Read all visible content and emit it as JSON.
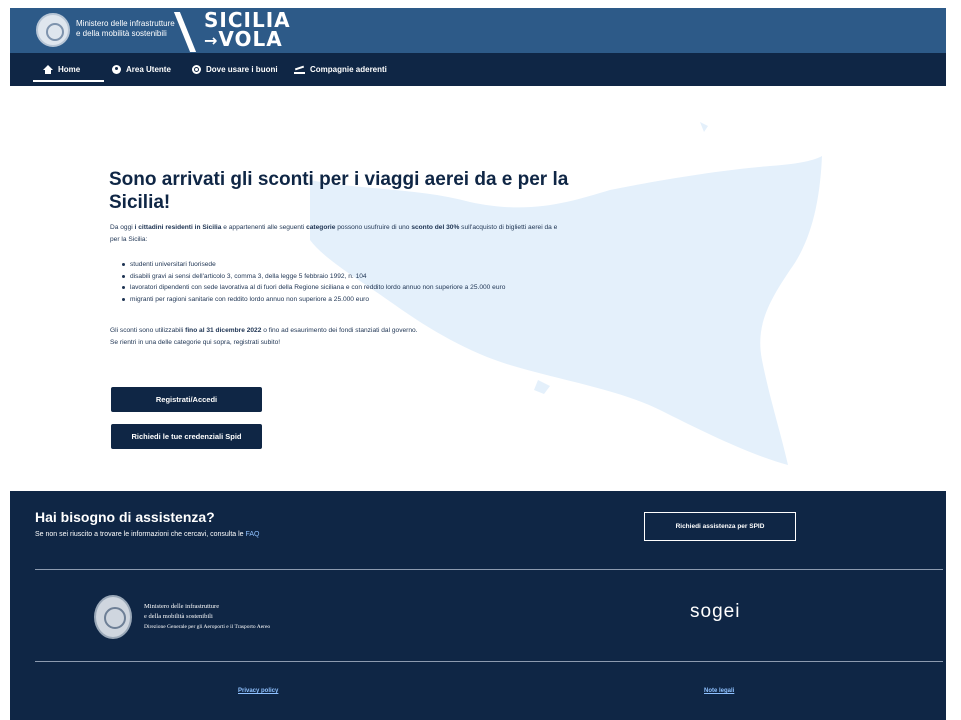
{
  "header": {
    "ministry_line1": "Ministero delle infrastrutture",
    "ministry_line2": "e della mobilità sostenibili",
    "logo_line1": "SICILIA",
    "logo_line2": "VOLA",
    "logo_plane_glyph": "→"
  },
  "nav": {
    "items": [
      {
        "label": "Home",
        "icon": "home-icon",
        "active": true
      },
      {
        "label": "Area Utente",
        "icon": "user-icon",
        "active": false
      },
      {
        "label": "Dove usare i buoni",
        "icon": "target-icon",
        "active": false
      },
      {
        "label": "Compagnie aderenti",
        "icon": "plane-icon",
        "active": false
      }
    ]
  },
  "hero": {
    "title": "Sono arrivati gli sconti per i viaggi aerei da e per la Sicilia!",
    "intro": {
      "t1": "Da oggi ",
      "b1": "i cittadini residenti in Sicilia",
      "t2": " e appartenenti alle seguenti ",
      "b2": "categorie",
      "t3": " possono usufruire di uno ",
      "b3": "sconto del 30%",
      "t4": " sull'acquisto di biglietti aerei da e per la Sicilia:"
    },
    "list": [
      "studenti universitari fuorisede",
      "disabili gravi ai sensi dell'articolo 3, comma 3, della legge 5 febbraio 1992, n. 104",
      "lavoratori dipendenti con sede lavorativa al di fuori della Regione siciliana e con reddito lordo annuo non superiore a 25.000 euro",
      "migranti per ragioni sanitarie con reddito lordo annuo non superiore a 25.000 euro"
    ],
    "note": {
      "t1": "Gli sconti sono utilizzabili ",
      "b1": "fino al 31 dicembre 2022",
      "t2": " o fino ad esaurimento dei fondi stanziati dal governo.",
      "line2": "Se rientri in una delle categorie qui sopra, registrati subito!"
    },
    "btn_register": "Registrati/Accedi",
    "btn_spid": "Richiedi le tue credenziali Spid"
  },
  "footer": {
    "help_title": "Hai bisogno di assistenza?",
    "help_text": "Se non sei riuscito a trovare le informazioni che cercavi, consulta le ",
    "faq_link": "FAQ",
    "btn_spid_help": "Richiedi assistenza per SPID",
    "ministry_line1": "Ministero delle infrastrutture",
    "ministry_line2": "e della mobilità sostenibili",
    "ministry_line3": "Direzione Generale per gli Aeroporti e il Trasporto Aereo",
    "partner_logo": "sogei",
    "privacy_link": "Privacy policy",
    "legal_link": "Note legali"
  },
  "colors": {
    "header_blue": "#2d5a88",
    "navy": "#0f2645",
    "map_light_blue": "#e4f0fb",
    "link_blue": "#8fc1ff"
  }
}
